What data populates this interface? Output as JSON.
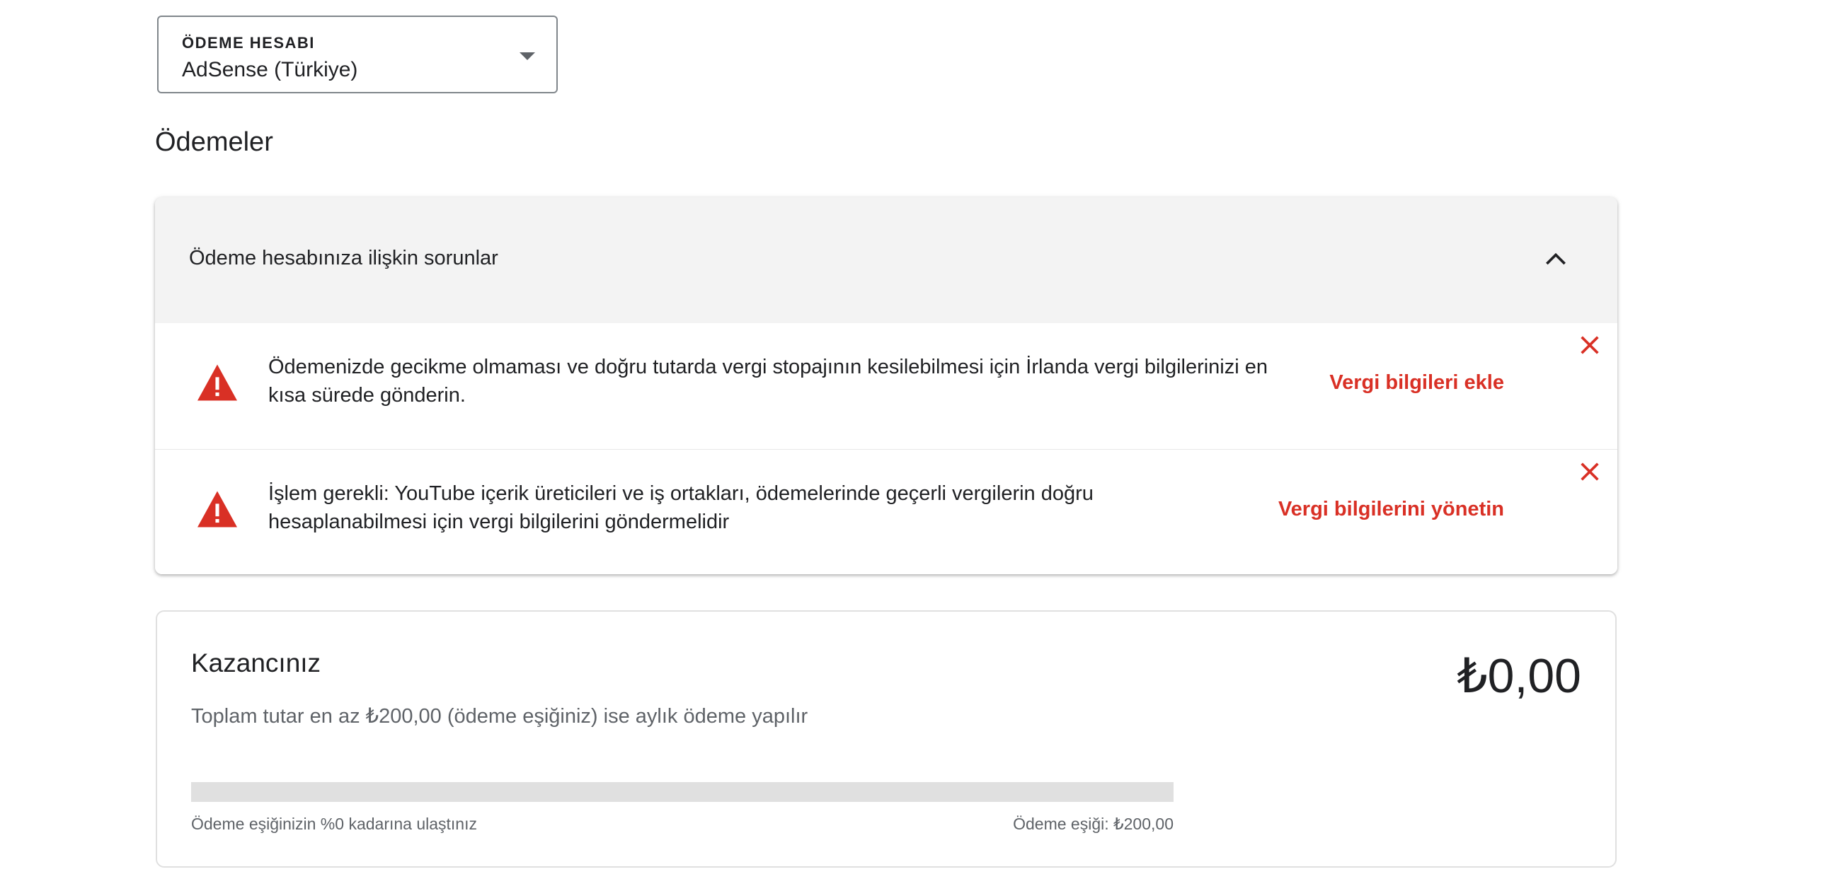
{
  "account": {
    "label": "ÖDEME HESABI",
    "value": "AdSense (Türkiye)"
  },
  "section_title": "Ödemeler",
  "issues": {
    "header": "Ödeme hesabınıza ilişkin sorunlar",
    "items": [
      {
        "text": "Ödemenizde gecikme olmaması ve doğru tutarda vergi stopajının kesilebilmesi için İrlanda vergi bilgilerinizi en kısa sürede gönderin.",
        "action": "Vergi bilgileri ekle"
      },
      {
        "text": "İşlem gerekli: YouTube içerik üreticileri ve iş ortakları, ödemelerinde geçerli vergilerin doğru hesaplanabilmesi için vergi bilgilerini göndermelidir",
        "action": "Vergi bilgilerini yönetin"
      }
    ]
  },
  "earnings": {
    "title": "Kazancınız",
    "amount": "₺0,00",
    "description": "Toplam tutar en az ₺200,00 (ödeme eşiğiniz) ise aylık ödeme yapılır",
    "progress_fraction": 0,
    "progress_left_label": "Ödeme eşiğinizin %0 kadarına ulaştınız",
    "progress_right_label": "Ödeme eşiği: ₺200,00"
  },
  "colors": {
    "accent_red": "#d93025",
    "warning_icon": "#d93025",
    "progress_track": "#e0e0e0"
  }
}
